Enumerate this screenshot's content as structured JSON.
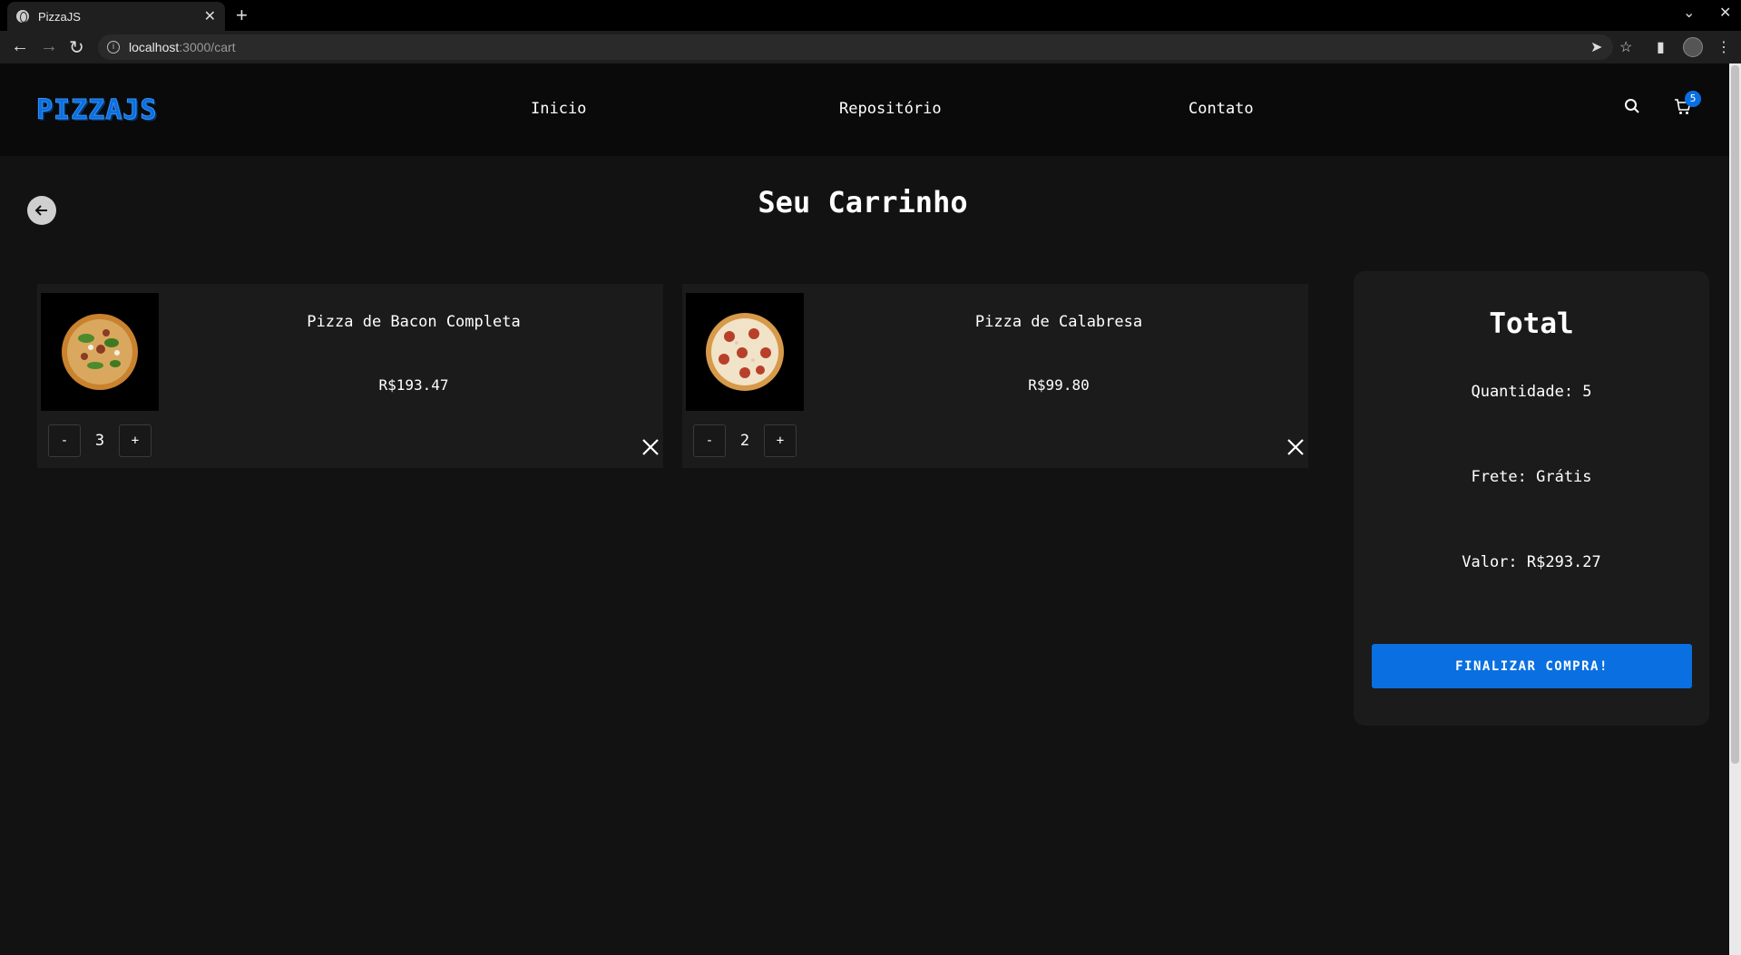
{
  "browser": {
    "tab_title": "PizzaJS",
    "url_host": "localhost",
    "url_path": ":3000/cart"
  },
  "header": {
    "logo": "PIZZAJS",
    "nav": [
      "Inicio",
      "Repositório",
      "Contato"
    ],
    "cart_count": "5"
  },
  "page_title": "Seu Carrinho",
  "cart_items": [
    {
      "name": "Pizza de Bacon Completa",
      "price": "R$193.47",
      "quantity": "3",
      "decrement": "-",
      "increment": "+"
    },
    {
      "name": "Pizza de Calabresa",
      "price": "R$99.80",
      "quantity": "2",
      "decrement": "-",
      "increment": "+"
    }
  ],
  "summary": {
    "title": "Total",
    "quantity_line": "Quantidade: 5",
    "shipping_line": "Frete: Grátis",
    "value_line": "Valor: R$293.27",
    "checkout_label": "FINALIZAR COMPRA!"
  },
  "colors": {
    "accent": "#0a6fe0",
    "background": "#121212",
    "card": "#1b1b1b"
  }
}
